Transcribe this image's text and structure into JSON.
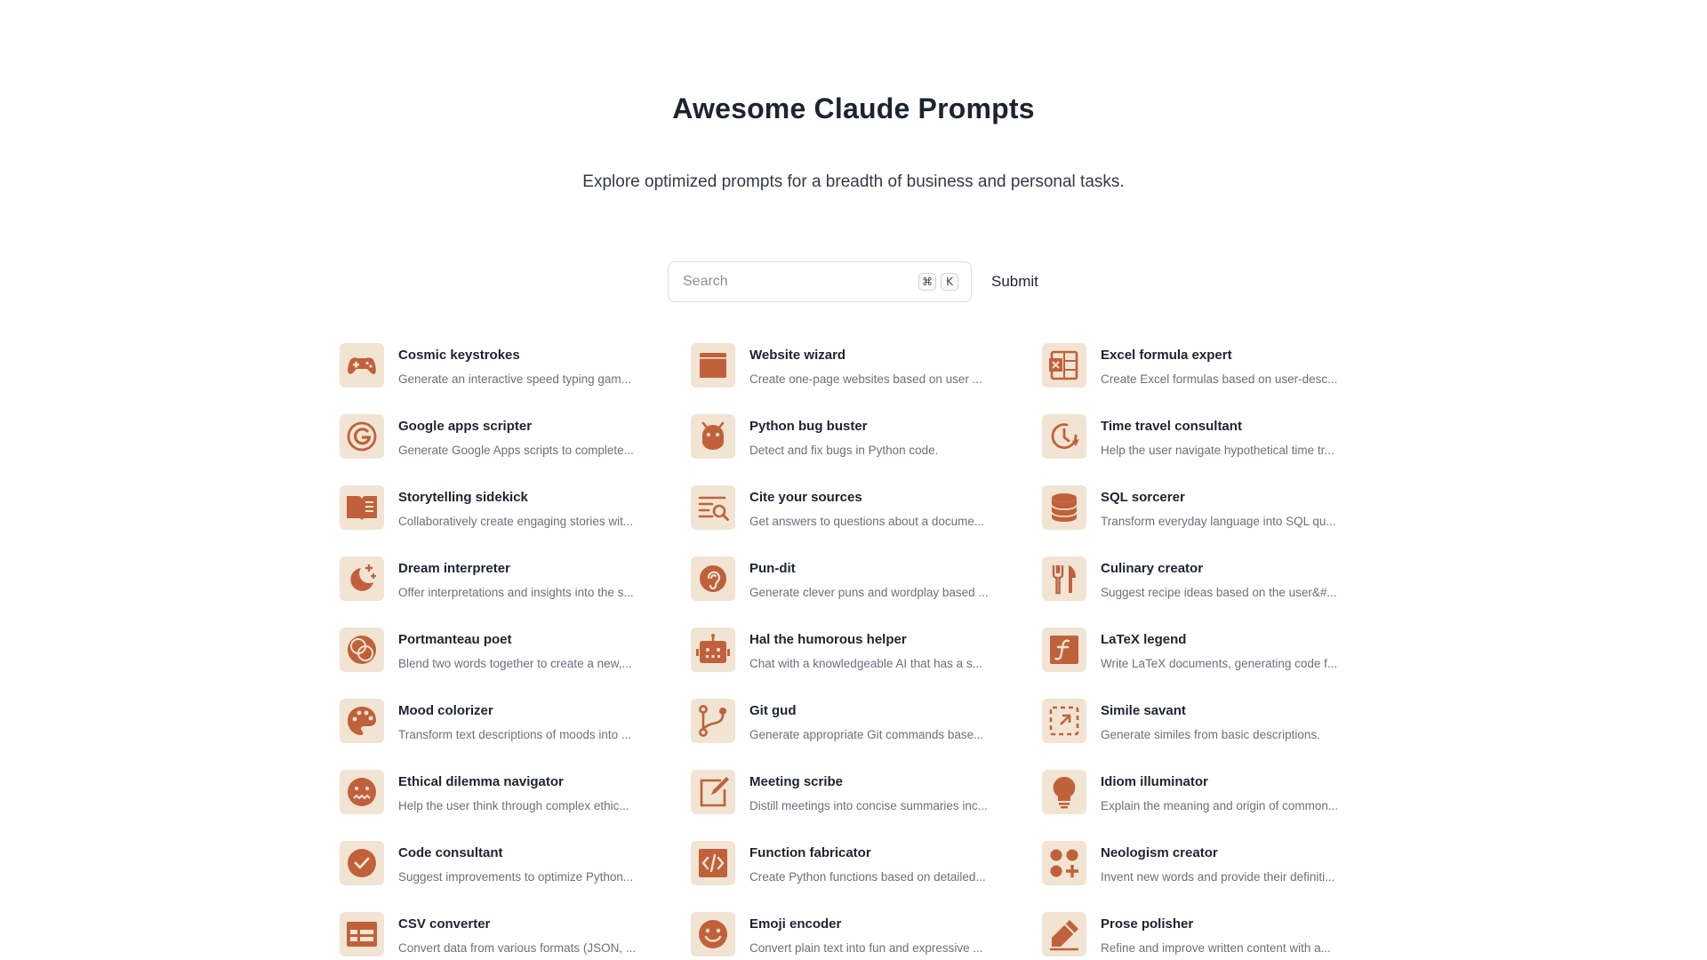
{
  "header": {
    "title": "Awesome Claude Prompts",
    "subtitle": "Explore optimized prompts for a breadth of business and personal tasks."
  },
  "search": {
    "placeholder": "Search",
    "value": "",
    "shortcut_keys": [
      "⌘",
      "K"
    ],
    "submit_label": "Submit"
  },
  "colors": {
    "accent": "#c0613b",
    "icon_tile_bg": "#f1e4d3"
  },
  "prompts": [
    {
      "title": "Cosmic keystrokes",
      "description": "Generate an interactive speed typing gam...",
      "icon": "gamepad-icon"
    },
    {
      "title": "Website wizard",
      "description": "Create one-page websites based on user ...",
      "icon": "browser-window-icon"
    },
    {
      "title": "Excel formula expert",
      "description": "Create Excel formulas based on user-desc...",
      "icon": "spreadsheet-icon"
    },
    {
      "title": "Google apps scripter",
      "description": "Generate Google Apps scripts to complete...",
      "icon": "google-icon"
    },
    {
      "title": "Python bug buster",
      "description": "Detect and fix bugs in Python code.",
      "icon": "bug-icon"
    },
    {
      "title": "Time travel consultant",
      "description": "Help the user navigate hypothetical time tr...",
      "icon": "clock-icon"
    },
    {
      "title": "Storytelling sidekick",
      "description": "Collaboratively create engaging stories wit...",
      "icon": "book-icon"
    },
    {
      "title": "Cite your sources",
      "description": "Get answers to questions about a docume...",
      "icon": "text-search-icon"
    },
    {
      "title": "SQL sorcerer",
      "description": "Transform everyday language into SQL qu...",
      "icon": "database-icon"
    },
    {
      "title": "Dream interpreter",
      "description": "Offer interpretations and insights into the s...",
      "icon": "moon-stars-icon"
    },
    {
      "title": "Pun-dit",
      "description": "Generate clever puns and wordplay based ...",
      "icon": "ear-icon"
    },
    {
      "title": "Culinary creator",
      "description": "Suggest recipe ideas based on the user&#...",
      "icon": "fork-knife-icon"
    },
    {
      "title": "Portmanteau poet",
      "description": "Blend two words together to create a new,...",
      "icon": "overlap-circles-icon"
    },
    {
      "title": "Hal the humorous helper",
      "description": "Chat with a knowledgeable AI that has a s...",
      "icon": "robot-icon"
    },
    {
      "title": "LaTeX legend",
      "description": "Write LaTeX documents, generating code f...",
      "icon": "function-icon"
    },
    {
      "title": "Mood colorizer",
      "description": "Transform text descriptions of moods into ...",
      "icon": "palette-icon"
    },
    {
      "title": "Git gud",
      "description": "Generate appropriate Git commands base...",
      "icon": "git-branch-icon"
    },
    {
      "title": "Simile savant",
      "description": "Generate similes from basic descriptions.",
      "icon": "dashed-square-arrow-icon"
    },
    {
      "title": "Ethical dilemma navigator",
      "description": "Help the user think through complex ethic...",
      "icon": "confused-face-icon"
    },
    {
      "title": "Meeting scribe",
      "description": "Distill meetings into concise summaries inc...",
      "icon": "note-pencil-icon"
    },
    {
      "title": "Idiom illuminator",
      "description": "Explain the meaning and origin of common...",
      "icon": "lightbulb-icon"
    },
    {
      "title": "Code consultant",
      "description": "Suggest improvements to optimize Python...",
      "icon": "check-circle-icon"
    },
    {
      "title": "Function fabricator",
      "description": "Create Python functions based on detailed...",
      "icon": "code-icon"
    },
    {
      "title": "Neologism creator",
      "description": "Invent new words and provide their definiti...",
      "icon": "circles-plus-icon"
    },
    {
      "title": "CSV converter",
      "description": "Convert data from various formats (JSON, ...",
      "icon": "table-icon"
    },
    {
      "title": "Emoji encoder",
      "description": "Convert plain text into fun and expressive ...",
      "icon": "smiley-icon"
    },
    {
      "title": "Prose polisher",
      "description": "Refine and improve written content with a...",
      "icon": "pencil-icon"
    }
  ]
}
